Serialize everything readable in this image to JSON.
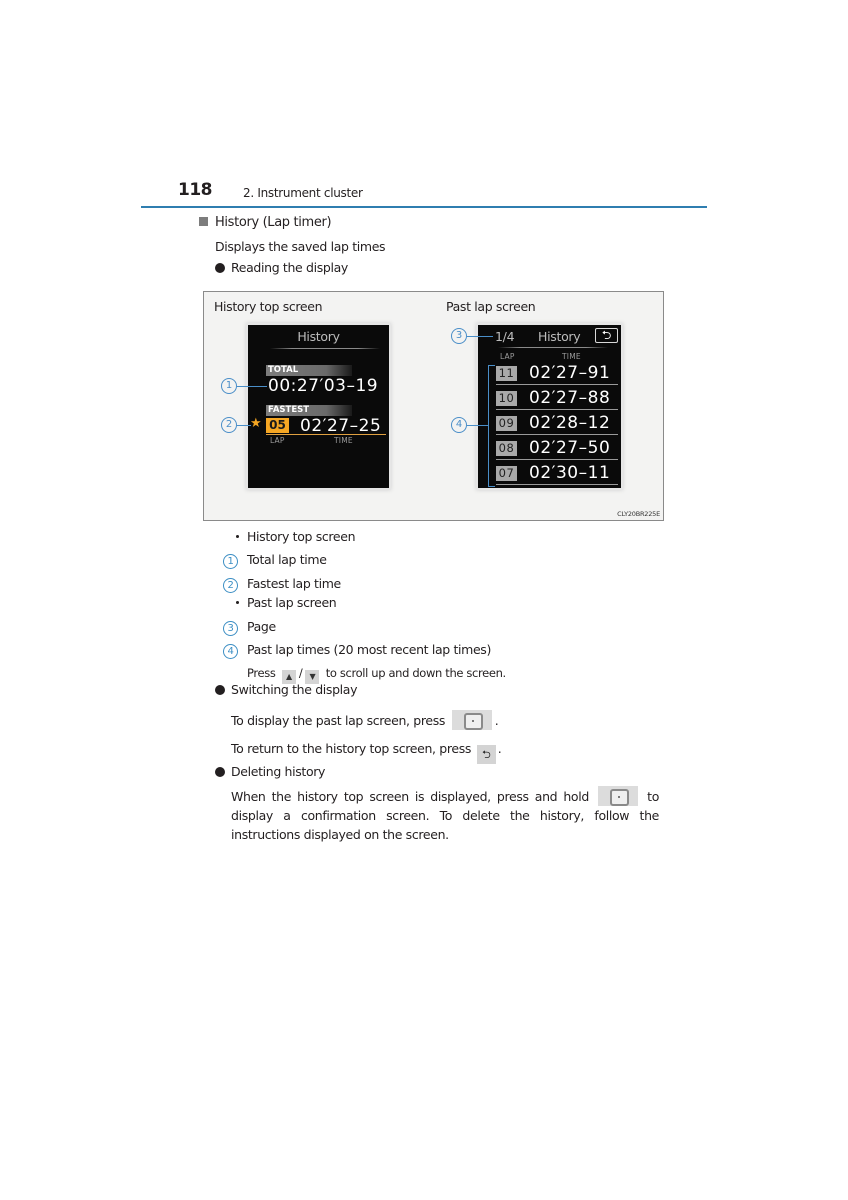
{
  "header": {
    "page_number": "118",
    "section": "2. Instrument cluster",
    "accent_color": "#2f7eb0"
  },
  "heading": "History (Lap timer)",
  "intro": "Displays the saved lap times",
  "bullets": {
    "reading": "Reading the display",
    "switching": "Switching the display",
    "deleting": "Deleting history"
  },
  "figure": {
    "left_label": "History top screen",
    "right_label": "Past lap screen",
    "code": "CLY20BR225E",
    "history_top": {
      "title": "History",
      "total_label": "TOTAL",
      "total_time": "00:27′03–19",
      "fastest_label": "FASTEST",
      "fastest_lap": "05",
      "fastest_time": "02′27–25",
      "lap_col": "LAP",
      "time_col": "TIME"
    },
    "past_lap": {
      "page": "1/4",
      "title": "History",
      "back_icon": "return-arrow-icon",
      "lap_col": "LAP",
      "time_col": "TIME",
      "rows": [
        {
          "lap": "11",
          "time": "02′27–91"
        },
        {
          "lap": "10",
          "time": "02′27–88"
        },
        {
          "lap": "09",
          "time": "02′28–12"
        },
        {
          "lap": "08",
          "time": "02′27–50"
        },
        {
          "lap": "07",
          "time": "02′30–11"
        }
      ]
    },
    "callouts": [
      "1",
      "2",
      "3",
      "4"
    ]
  },
  "legend": {
    "history_top": "History top screen",
    "items_top": [
      {
        "num": "1",
        "text": "Total lap time"
      },
      {
        "num": "2",
        "text": "Fastest lap time"
      }
    ],
    "past_lap": "Past lap screen",
    "items_past": [
      {
        "num": "3",
        "text": "Page"
      },
      {
        "num": "4",
        "text": "Past lap times (20 most recent lap times)"
      }
    ],
    "scroll_press": "Press",
    "scroll_sep": "/",
    "scroll_rest": "to scroll up and down the screen.",
    "up_icon": "⬆",
    "down_icon": "⬇"
  },
  "switching": {
    "line1": "To display the past lap screen, press",
    "line1_end": ".",
    "line2": "To return to the history top screen, press",
    "line2_end": ".",
    "back_glyph": "⮌"
  },
  "deleting": {
    "text_before": "When the history top screen is displayed, press and hold",
    "text_after": "to display a confirmation screen. To delete the history, follow the instructions displayed on the screen."
  }
}
